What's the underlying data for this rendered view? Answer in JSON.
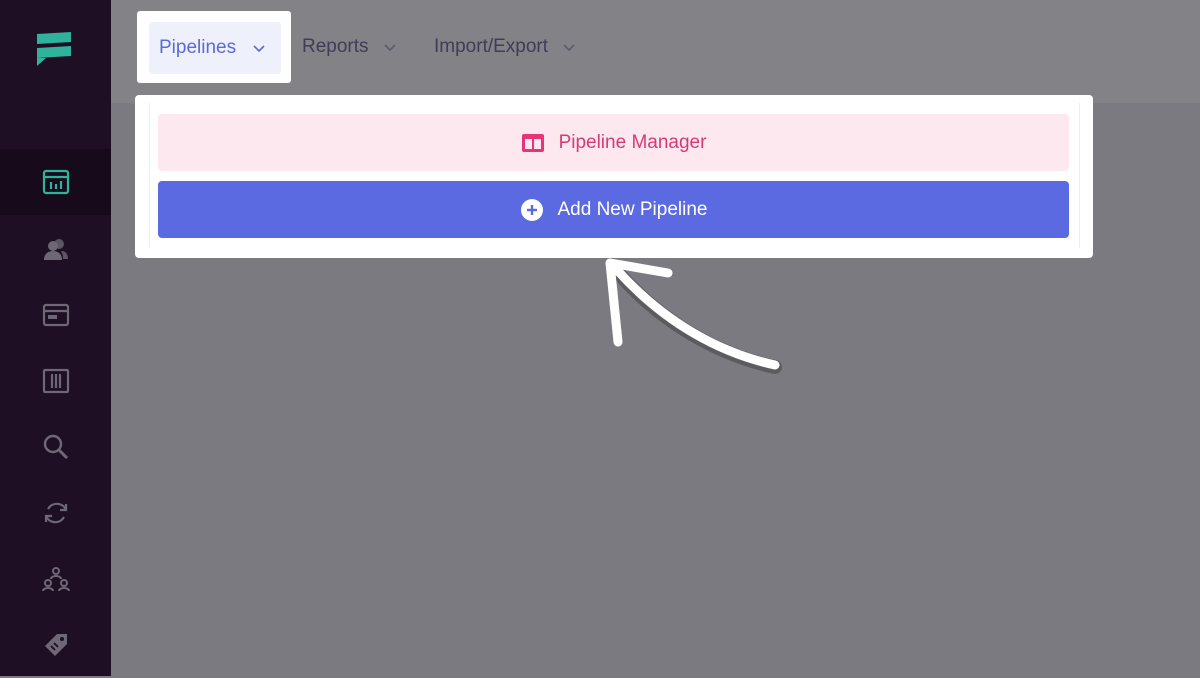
{
  "sidebar": {
    "items": [
      {
        "icon": "dashboard-icon",
        "active": true
      },
      {
        "icon": "contacts-icon",
        "active": false
      },
      {
        "icon": "window-icon",
        "active": false
      },
      {
        "icon": "columns-icon",
        "active": false
      },
      {
        "icon": "search-icon",
        "active": false
      },
      {
        "icon": "sync-icon",
        "active": false
      },
      {
        "icon": "team-icon",
        "active": false
      },
      {
        "icon": "tag-icon",
        "active": false
      }
    ]
  },
  "topnav": {
    "tabs": [
      {
        "label": "Pipelines",
        "active": true
      },
      {
        "label": "Reports",
        "active": false
      },
      {
        "label": "Import/Export",
        "active": false
      }
    ]
  },
  "dropdown": {
    "items": [
      {
        "label": "Pipeline Manager",
        "icon": "columns-layout-icon"
      },
      {
        "label": "Add New Pipeline",
        "icon": "plus-circle-icon"
      }
    ]
  },
  "colors": {
    "sidebar_bg": "#1f0f24",
    "accent_teal": "#2fb39a",
    "primary": "#5b6ae0",
    "pink": "#d63a74"
  }
}
